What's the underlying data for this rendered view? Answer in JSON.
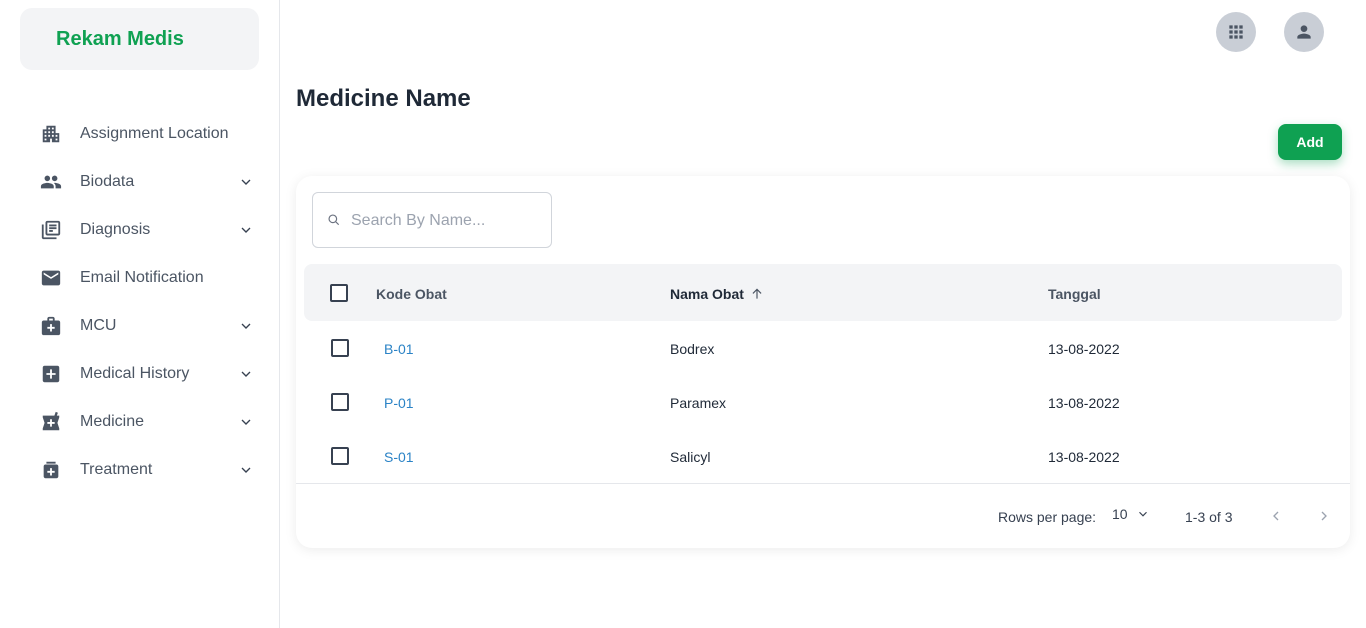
{
  "brand": {
    "title": "Rekam Medis"
  },
  "sidebar": {
    "items": [
      {
        "label": "Assignment Location",
        "icon": "building-icon",
        "expandable": false
      },
      {
        "label": "Biodata",
        "icon": "people-icon",
        "expandable": true
      },
      {
        "label": "Diagnosis",
        "icon": "notes-icon",
        "expandable": true
      },
      {
        "label": "Email Notification",
        "icon": "mail-icon",
        "expandable": false
      },
      {
        "label": "MCU",
        "icon": "medkit-icon",
        "expandable": true
      },
      {
        "label": "Medical History",
        "icon": "medical-plus-icon",
        "expandable": true
      },
      {
        "label": "Medicine",
        "icon": "pharmacy-icon",
        "expandable": true
      },
      {
        "label": "Treatment",
        "icon": "medication-icon",
        "expandable": true
      }
    ]
  },
  "header": {
    "apps_icon": "apps-grid-icon",
    "user_icon": "user-icon"
  },
  "main": {
    "title": "Medicine Name",
    "add_label": "Add",
    "search": {
      "placeholder": "Search By Name...",
      "value": ""
    },
    "table": {
      "columns": [
        "Kode Obat",
        "Nama Obat",
        "Tanggal"
      ],
      "sorted_column": "Nama Obat",
      "sort_direction": "asc",
      "rows": [
        {
          "code": "B-01",
          "name": "Bodrex",
          "date": "13-08-2022"
        },
        {
          "code": "P-01",
          "name": "Paramex",
          "date": "13-08-2022"
        },
        {
          "code": "S-01",
          "name": "Salicyl",
          "date": "13-08-2022"
        }
      ]
    },
    "pagination": {
      "rows_per_page_label": "Rows per page:",
      "rows_per_page": "10",
      "range": "1-3 of 3"
    }
  },
  "colors": {
    "accent": "#0fa152",
    "link": "#2b83c6",
    "icon_bg": "#c9ced6"
  }
}
